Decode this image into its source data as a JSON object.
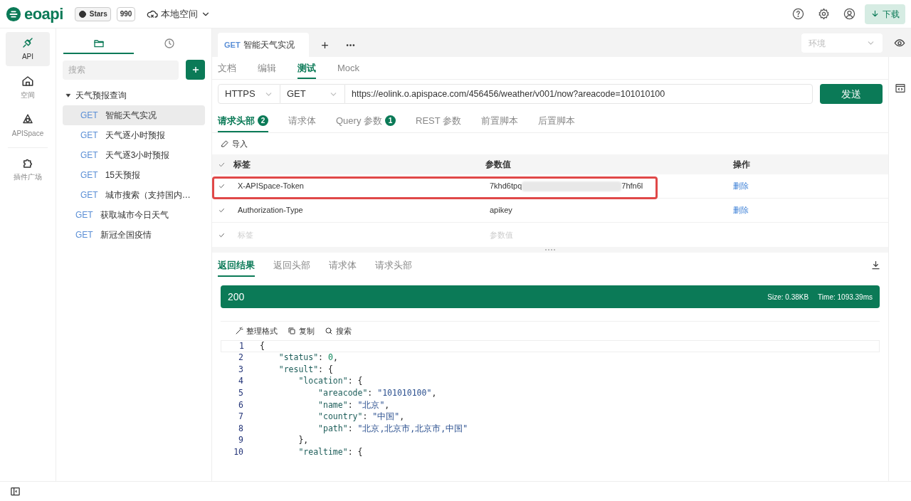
{
  "header": {
    "logo": "eoapi",
    "stars_label": "Stars",
    "stars_count": "990",
    "workspace": "本地空间",
    "download": "下载"
  },
  "rail": [
    {
      "label": "API",
      "selected": true
    },
    {
      "label": "空间",
      "selected": false
    },
    {
      "label": "APISpace",
      "selected": false
    },
    {
      "label": "插件广场",
      "selected": false
    }
  ],
  "side_tabs": [
    {
      "selected": true
    },
    {
      "selected": false
    }
  ],
  "search": {
    "placeholder": "搜索"
  },
  "tree": [
    {
      "label": "天气预报查询",
      "expanded": true,
      "children": [
        {
          "method": "GET",
          "label": "智能天气实况",
          "selected": true
        },
        {
          "method": "GET",
          "label": "天气逐小时预报",
          "selected": false
        },
        {
          "method": "GET",
          "label": "天气逐3小时预报",
          "selected": false
        },
        {
          "method": "GET",
          "label": "15天预报",
          "selected": false
        },
        {
          "method": "GET",
          "label": "城市搜索（支持国内…",
          "selected": false
        }
      ]
    },
    {
      "method": "GET",
      "label": "获取城市今日天气",
      "selected": false
    },
    {
      "method": "GET",
      "label": "新冠全国疫情",
      "selected": false
    }
  ],
  "open_tab": {
    "method": "GET",
    "title": "智能天气实况"
  },
  "env": {
    "placeholder": "环境"
  },
  "view_tabs": [
    {
      "label": "文档",
      "selected": false
    },
    {
      "label": "编辑",
      "selected": false
    },
    {
      "label": "测试",
      "selected": true
    },
    {
      "label": "Mock",
      "selected": false
    }
  ],
  "request": {
    "protocol": "HTTPS",
    "method": "GET",
    "url": "https://eolink.o.apispace.com/456456/weather/v001/now?areacode=101010100",
    "send": "发送"
  },
  "request_tabs": [
    {
      "label": "请求头部",
      "count": "2",
      "selected": true
    },
    {
      "label": "请求体",
      "selected": false
    },
    {
      "label": "Query 参数",
      "count": "1",
      "selected": false
    },
    {
      "label": "REST 参数",
      "selected": false
    },
    {
      "label": "前置脚本",
      "selected": false
    },
    {
      "label": "后置脚本",
      "selected": false
    }
  ],
  "import": "导入",
  "headers_table": {
    "columns": [
      "标签",
      "参数值",
      "操作"
    ],
    "rows": [
      {
        "checked": true,
        "name": "X-APISpace-Token",
        "value_parts": [
          "7khd6tpq",
          "7hfn6l"
        ],
        "redacted": true,
        "action": "删除",
        "highlighted": true
      },
      {
        "checked": true,
        "name": "Authorization-Type",
        "value_parts": [
          "apikey"
        ],
        "redacted": false,
        "action": "删除",
        "highlighted": false
      }
    ],
    "new_row": {
      "checked": true,
      "name_placeholder": "标签",
      "value_placeholder": "参数值"
    }
  },
  "response_tabs": [
    {
      "label": "返回结果",
      "selected": true
    },
    {
      "label": "返回头部",
      "selected": false
    },
    {
      "label": "请求体",
      "selected": false
    },
    {
      "label": "请求头部",
      "selected": false
    }
  ],
  "status": {
    "code": "200",
    "size": "Size: 0.38KB",
    "time": "Time: 1093.39ms"
  },
  "code_tools": [
    {
      "label": "整理格式"
    },
    {
      "label": "复制"
    },
    {
      "label": "搜索"
    }
  ],
  "code_lines": [
    {
      "number": "1",
      "text": "{"
    },
    {
      "number": "2",
      "text": "    \"status\": 0,"
    },
    {
      "number": "3",
      "text": "    \"result\": {"
    },
    {
      "number": "4",
      "text": "        \"location\": {"
    },
    {
      "number": "5",
      "text": "            \"areacode\": \"101010100\","
    },
    {
      "number": "6",
      "text": "            \"name\": \"北京\","
    },
    {
      "number": "7",
      "text": "            \"country\": \"中国\","
    },
    {
      "number": "8",
      "text": "            \"path\": \"北京,北京市,北京市,中国\""
    },
    {
      "number": "9",
      "text": "        },"
    },
    {
      "number": "10",
      "text": "        \"realtime\": {"
    }
  ]
}
